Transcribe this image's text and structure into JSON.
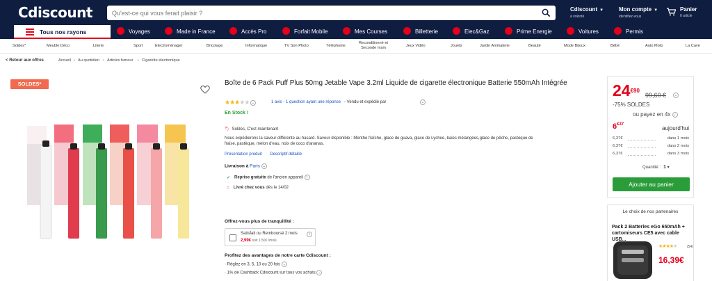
{
  "header": {
    "logo": "Cdiscount",
    "search_placeholder": "Qu'est-ce qui vous ferait plaisir ?",
    "links": [
      {
        "title": "Cdiscount",
        "sub": "à volonté"
      },
      {
        "title": "Mon compte",
        "sub": "Identifiez-vous"
      },
      {
        "title": "Panier",
        "sub": "0 article"
      }
    ]
  },
  "nav": {
    "rayons": "Tous nos rayons",
    "items": [
      "Voyages",
      "Made in France",
      "Accès Pro",
      "Forfait Mobile",
      "Mes Courses",
      "Billetterie",
      "Elec&Gaz",
      "Prime Energie",
      "Voitures",
      "Permis"
    ]
  },
  "categories": [
    "Soldes*",
    "Meuble Déco",
    "Literie",
    "Sport",
    "Electroménager",
    "Bricolage",
    "Informatique",
    "TV Son Photo",
    "Téléphonie",
    "Reconditionné et",
    "Seconde main",
    "Jeux Vidéo",
    "Jouets",
    "Jardin Animalerie",
    "Beauté",
    "Mode Bijoux",
    "Bébé",
    "Auto Moto",
    "La Cave"
  ],
  "breadcrumb": {
    "back": "Retour aux offres",
    "items": [
      "Accueil",
      "Au quotidien",
      "Articles fumeur",
      "Cigarette électronique"
    ]
  },
  "badge": "SOLDES*",
  "product": {
    "title": "Boîte de 6 Pack Puff Plus 50mg Jetable Vape 3.2ml Liquide de cigarette électronique Batterie 550mAh Intégrée",
    "rating": 3,
    "reviews": "1 avis - 1 question ayant une réponse",
    "seller": "- Vendu et expédié par",
    "stock": "En Stock !",
    "tagline": "Soldes, C'est maintenant",
    "desc1": "Nous expédierons la saveur différente au hasard. Saveur disponible : Menthe fraîche, glace de guava, glace de Lychee, baies mélangées,glace de pêche, pastèque de",
    "desc2": "fraise, pastèque, melon d'eau, noix de coco d'ananas.",
    "link1": "Présentation produit",
    "link2": "Descriptif détaillé",
    "delivery_label": "Livraison à",
    "delivery_city": "Paris",
    "reprise": "Reprise gratuite",
    "reprise_rest": "de l'ancien appareil",
    "livre": "Livré chez vous",
    "livre_date": "dès le 14/02",
    "tranq_title": "Offrez-vous plus de tranquillité :",
    "tranq_text": "Satisfait ou Remboursé 2 mois",
    "tranq_price": "2,99€",
    "tranq_sub": "soit 1,50€ /mois",
    "carte_title": "Profitez des avantages de notre carte Cdiscount :",
    "carte1": "· Réglez en 3, 5, 10 ou 20 fois",
    "carte2": "· 1% de Cashback Cdiscount sur tous vos achats"
  },
  "price": {
    "main": "24",
    "cents": "€90",
    "old": "99,60 €",
    "discount": "-75% SOLDES",
    "pay_or": "ou payez en 4x",
    "inst_main": "6",
    "inst_cents": "€37",
    "today": "aujourd'hui",
    "rows": [
      {
        "amount": "6,37€",
        "when": "dans 1 mois"
      },
      {
        "amount": "6,37€",
        "when": "dans 2 mois"
      },
      {
        "amount": "6,37€",
        "when": "dans 3 mois"
      }
    ],
    "qty_label": "Quantité :",
    "qty": "1",
    "add": "Ajouter au panier"
  },
  "partner": {
    "header": "Le choix de nos partenaires",
    "title": "Pack 2 Batteries eGo 650mAh + cartomiseurs CE5 avec cable USB...",
    "rating": 3.5,
    "count": "(54)",
    "price": "16,39€"
  },
  "colors": {
    "brand_navy": "#0f1d41",
    "red": "#e3001b",
    "green": "#2a9d3a",
    "soldes": "#f26a4f"
  }
}
